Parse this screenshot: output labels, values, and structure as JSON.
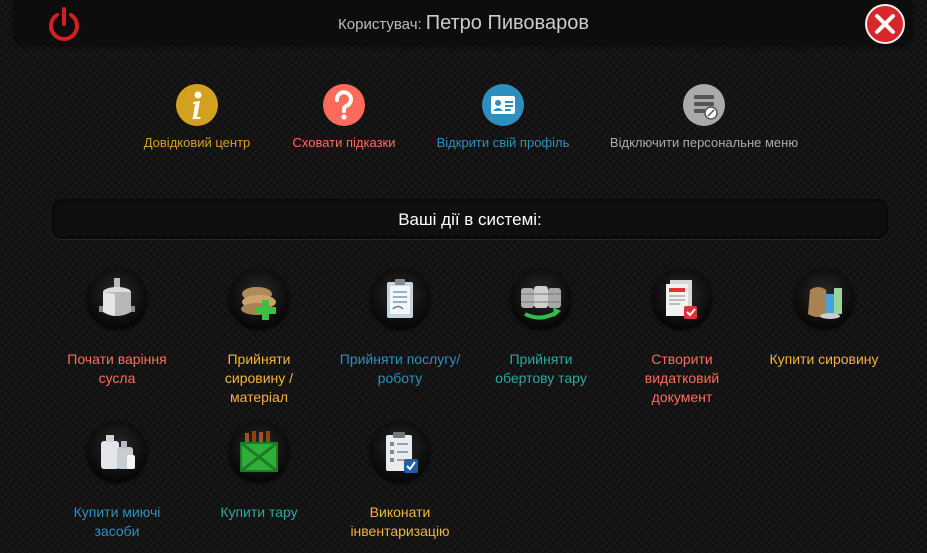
{
  "header": {
    "user_label": "Користувач:",
    "user_name": "Петро Пивоваров"
  },
  "quick_links": [
    {
      "label": "Довідковий центр",
      "icon": "info-icon",
      "color": "#d4a020"
    },
    {
      "label": "Сховати підказки",
      "icon": "question-icon",
      "color": "#ff6b5b"
    },
    {
      "label": "Відкрити свій профіль",
      "icon": "profile-card-icon",
      "color": "#2e8fbf"
    },
    {
      "label": "Відключити персональне меню",
      "icon": "menu-disable-icon",
      "color": "#aaaaaa"
    }
  ],
  "section_title": "Ваші дії в системі:",
  "actions": [
    {
      "label_lines": [
        "Почати варіння",
        "сусла"
      ],
      "icon": "brew-kettle-icon",
      "color": "#ff6b5b"
    },
    {
      "label_lines": [
        "Прийняти",
        "сировину /",
        "матеріал"
      ],
      "icon": "sacks-plus-icon",
      "color": "#f3b33d"
    },
    {
      "label_lines": [
        "Прийняти послугу/",
        "роботу"
      ],
      "icon": "clipboard-icon",
      "color": "#2e8fbf"
    },
    {
      "label_lines": [
        "Прийняти",
        "обертову тару"
      ],
      "icon": "kegs-icon",
      "color": "#2aa8a0"
    },
    {
      "label_lines": [
        "Створити",
        "видатковий",
        "документ"
      ],
      "icon": "documents-icon",
      "color": "#ff6b5b"
    },
    {
      "label_lines": [
        "Купити сировину"
      ],
      "icon": "raw-materials-icon",
      "color": "#f3b33d"
    },
    {
      "label_lines": [
        "Купити миючі",
        "засоби"
      ],
      "icon": "detergents-icon",
      "color": "#2e8fbf"
    },
    {
      "label_lines": [
        "Купити тару"
      ],
      "icon": "bottle-crate-icon",
      "color": "#2aa8a0"
    },
    {
      "label_lines": [
        "Виконати",
        "інвентаризацію"
      ],
      "icon": "inventory-checklist-icon",
      "color": "#f3b33d"
    }
  ]
}
